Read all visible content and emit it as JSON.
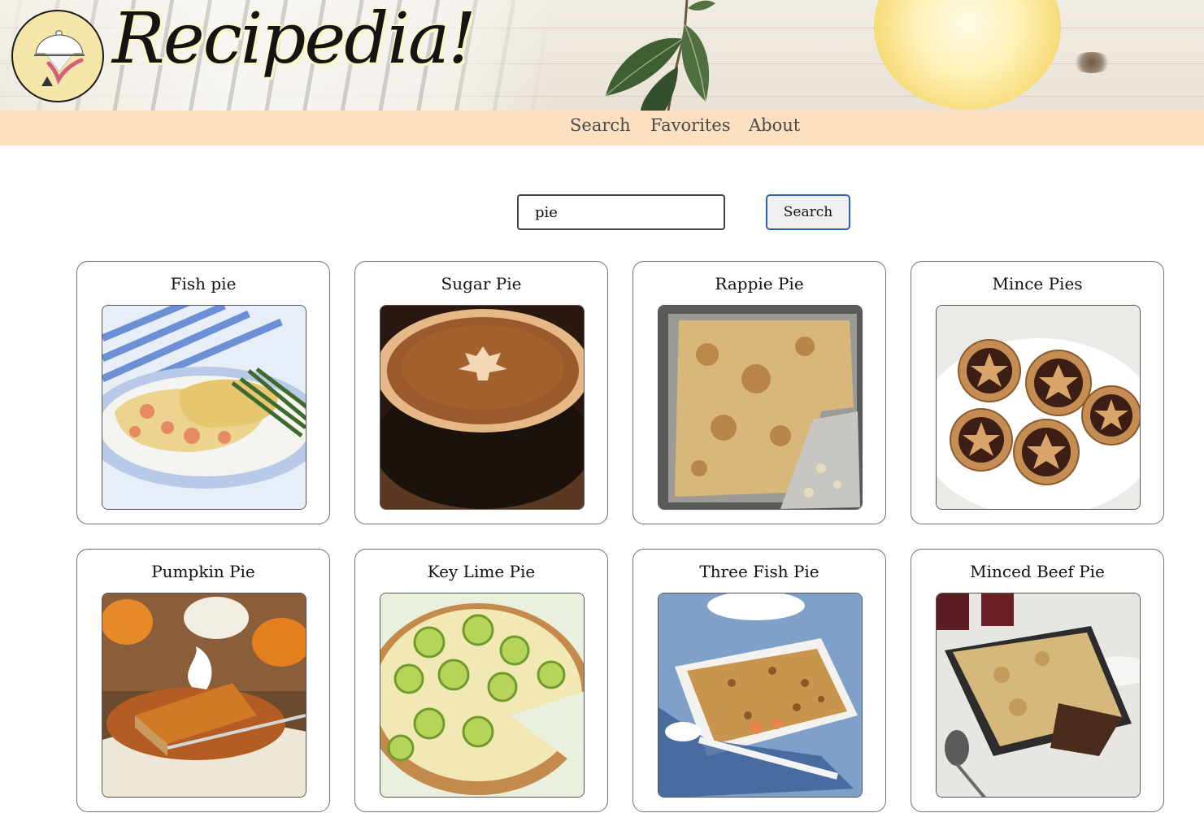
{
  "app": {
    "brand": "Recipedia!"
  },
  "nav": {
    "items": [
      {
        "label": "Search"
      },
      {
        "label": "Favorites"
      },
      {
        "label": "About"
      }
    ]
  },
  "search": {
    "value": "pie",
    "placeholder": "",
    "button_label": "Search"
  },
  "results": [
    {
      "title": "Fish pie"
    },
    {
      "title": "Sugar Pie"
    },
    {
      "title": "Rappie Pie"
    },
    {
      "title": "Mince Pies"
    },
    {
      "title": "Pumpkin Pie"
    },
    {
      "title": "Key Lime Pie"
    },
    {
      "title": "Three Fish Pie"
    },
    {
      "title": "Minced Beef Pie"
    }
  ],
  "colors": {
    "nav_background": "#fce0bf",
    "logo_background": "#f4e5a8",
    "button_border": "#2f5fb6"
  }
}
